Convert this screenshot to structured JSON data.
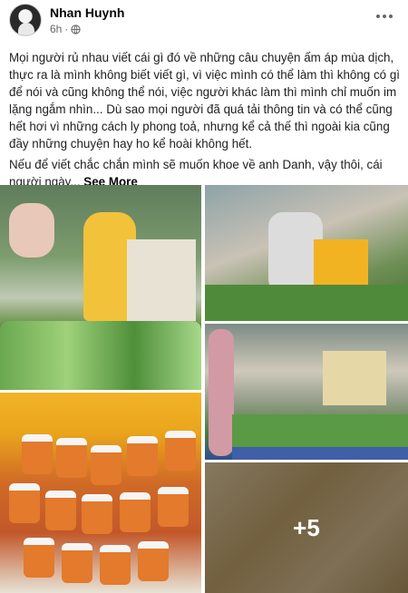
{
  "post": {
    "author": "Nhan Huynh",
    "time": "6h",
    "text": "Mọi người rủ nhau viết cái gì đó về những câu chuyện ấm áp mùa dịch, thực ra là mình không biết viết gì, vì việc mình có thể làm thì không có gì để nói và cũng không thể nói, việc người khác làm thì mình chỉ muốn im lặng ngắm nhìn... Dù sao mọi người đã quá tải thông tin và có thể cũng hết hơi vì những cách ly phong toả, nhưng kể cả thế thì ngoài kia cũng đầy những chuyện hay ho kể hoài không hết.",
    "text2": "Nếu để viết chắc chắn mình sẽ muốn khoe về anh Danh, vậy thôi, cái người ngày...",
    "see_more": "See More",
    "more_photos": "+5"
  },
  "icons": {
    "globe": "globe-icon",
    "more": "more-options-icon"
  },
  "colors": {
    "secondary_text": "#65676b",
    "overlay": "rgba(0,0,0,0.38)"
  }
}
